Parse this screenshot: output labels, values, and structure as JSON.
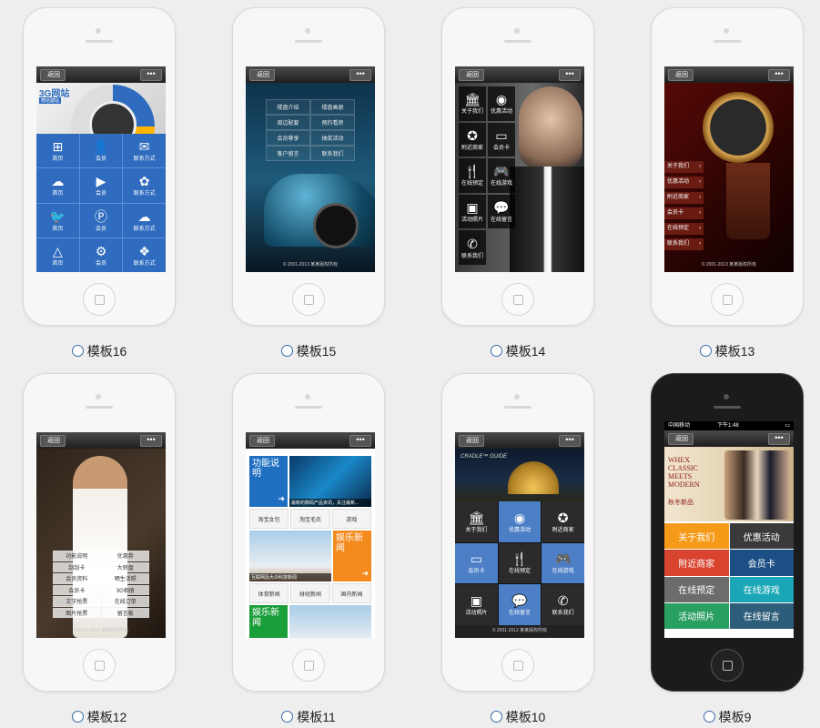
{
  "templates": [
    {
      "caption": "模板16"
    },
    {
      "caption": "模板15"
    },
    {
      "caption": "模板14"
    },
    {
      "caption": "模板13"
    },
    {
      "caption": "模板12"
    },
    {
      "caption": "模板11"
    },
    {
      "caption": "模板10"
    },
    {
      "caption": "模板9"
    }
  ],
  "common": {
    "back": "返回",
    "more": "•••",
    "copyright": "© 2001-2013 某某版权所有"
  },
  "t16": {
    "logo": "3G网站",
    "logo_sub": "微信建站",
    "items": [
      "首页",
      "会员",
      "联系方式",
      "首页",
      "会员",
      "联系方式",
      "首页",
      "会员",
      "联系方式",
      "首页",
      "会员",
      "联系方式"
    ]
  },
  "t15": {
    "menu": [
      "楼盘介绍",
      "楼盘画册",
      "周边配套",
      "预约看房",
      "会员尊享",
      "抽奖活动",
      "客户留言",
      "联系我们"
    ]
  },
  "t14": {
    "menu": [
      "关于我们",
      "优惠活动",
      "附近商家",
      "会员卡",
      "在线预定",
      "在线游戏",
      "活动照片",
      "在线留言",
      "联系我们"
    ]
  },
  "t13": {
    "menu": [
      "关于我们",
      "优惠活动",
      "附近商家",
      "会员卡",
      "在线预定",
      "联系我们"
    ]
  },
  "t12": {
    "menu": [
      "功能说明",
      "优惠券",
      "刮刮卡",
      "大转盘",
      "会员资料",
      "晒生活照",
      "会员卡",
      "3G相册",
      "文字抢票",
      "在线订单",
      "图片抢票",
      "留言板"
    ]
  },
  "t11": {
    "feature": "功能说明",
    "news_caption": "最新的数码产品资讯，关注最新...",
    "row1": [
      "淘宝女包",
      "淘宝毛衣",
      "游戏"
    ],
    "rocket_caption": "互联网及大众科技新闻",
    "ent": "娱乐新闻",
    "row2": [
      "体育新闻",
      "财经新闻",
      "国内新闻"
    ],
    "ent2": "娱乐新闻"
  },
  "t10": {
    "banner": "CRADLE™ GUIDE",
    "menu": [
      "关于我们",
      "优惠活动",
      "附近商家",
      "会员卡",
      "在线预定",
      "在线游戏",
      "活动照片",
      "在线留言",
      "联系我们"
    ]
  },
  "t9": {
    "status_left": "中国移动",
    "status_time": "下午1:48",
    "banner": "WHEX CLASSIC MEETS MODERN",
    "banner_sub": "秋冬新品",
    "menu": [
      "关于我们",
      "优惠活动",
      "附近商家",
      "会员卡",
      "在线预定",
      "在线游戏",
      "活动照片",
      "在线留言"
    ]
  },
  "colors": {
    "t16_blue": "#2f6cbf",
    "t10_blue": "#4d7fc6",
    "t9_colors": [
      "#f59a19",
      "#3a3a3a",
      "#d9442f",
      "#1b4f85",
      "#6c6c6c",
      "#1aa6b6",
      "#2a9f62",
      "#2d5d7a"
    ]
  }
}
